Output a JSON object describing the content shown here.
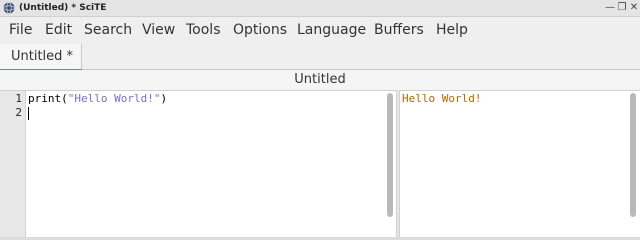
{
  "window": {
    "title": "(Untitled) * SciTE",
    "icon": "scite-globe-icon",
    "buttons": [
      "minimize",
      "restore",
      "close"
    ]
  },
  "menu": {
    "items": [
      "File",
      "Edit",
      "Search",
      "View",
      "Tools",
      "Options",
      "Language",
      "Buffers",
      "Help"
    ]
  },
  "tabs": [
    {
      "label": "Untitled *",
      "active": true
    }
  ],
  "document": {
    "title": "Untitled",
    "line_numbers": [
      "1",
      "2"
    ],
    "code": {
      "line1": {
        "func": "print(",
        "string": "\"Hello World!\"",
        "close": ")"
      },
      "line2": ""
    }
  },
  "output": {
    "text": "Hello World!"
  },
  "colors": {
    "string": "#7a6ec8",
    "output_text": "#b06a00",
    "tab_accent": "#4a90d9"
  }
}
